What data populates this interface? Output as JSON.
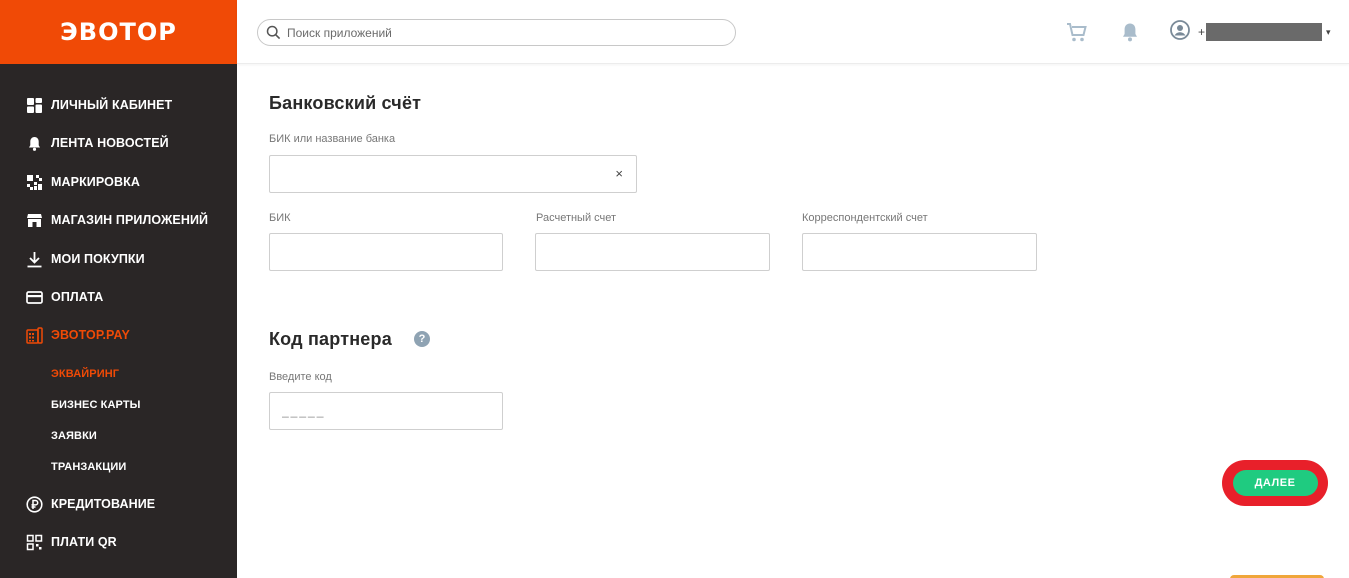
{
  "app": {
    "logo": "ЭВОТОР"
  },
  "colors": {
    "brand": "#f04a06",
    "sidebar_bg": "#2a2626",
    "accent_green": "#1fcb80",
    "highlight_red": "#e8202a"
  },
  "sidebar": {
    "items": [
      {
        "label": "ЛИЧНЫЙ КАБИНЕТ",
        "icon": "dashboard-icon"
      },
      {
        "label": "ЛЕНТА НОВОСТЕЙ",
        "icon": "bell-icon"
      },
      {
        "label": "МАРКИРОВКА",
        "icon": "qr-marking-icon"
      },
      {
        "label": "МАГАЗИН ПРИЛОЖЕНИЙ",
        "icon": "store-icon"
      },
      {
        "label": "МОИ ПОКУПКИ",
        "icon": "download-icon"
      },
      {
        "label": "ОПЛАТА",
        "icon": "card-icon"
      },
      {
        "label": "ЭВОТОР.PAY",
        "icon": "pay-terminal-icon",
        "active": true
      },
      {
        "label": "КРЕДИТОВАНИЕ",
        "icon": "ruble-icon"
      },
      {
        "label": "ПЛАТИ QR",
        "icon": "qr-icon"
      }
    ],
    "subitems": [
      {
        "label": "ЭКВАЙРИНГ",
        "active": true
      },
      {
        "label": "БИЗНЕС КАРТЫ"
      },
      {
        "label": "ЗАЯВКИ"
      },
      {
        "label": "ТРАНЗАКЦИИ"
      }
    ]
  },
  "header": {
    "search_placeholder": "Поиск приложений",
    "user_prefix": "+"
  },
  "bank_section": {
    "title": "Банковский счёт",
    "bank_search_label": "БИК или название банка",
    "bank_search_value": "",
    "clear_symbol": "×",
    "bik_label": "БИК",
    "account_label": "Расчетный счет",
    "corr_label": "Корреспондентский счет"
  },
  "partner_section": {
    "title": "Код партнера",
    "help_symbol": "?",
    "code_label": "Введите код",
    "code_placeholder": "_____"
  },
  "actions": {
    "next_label": "ДАЛЕЕ"
  }
}
